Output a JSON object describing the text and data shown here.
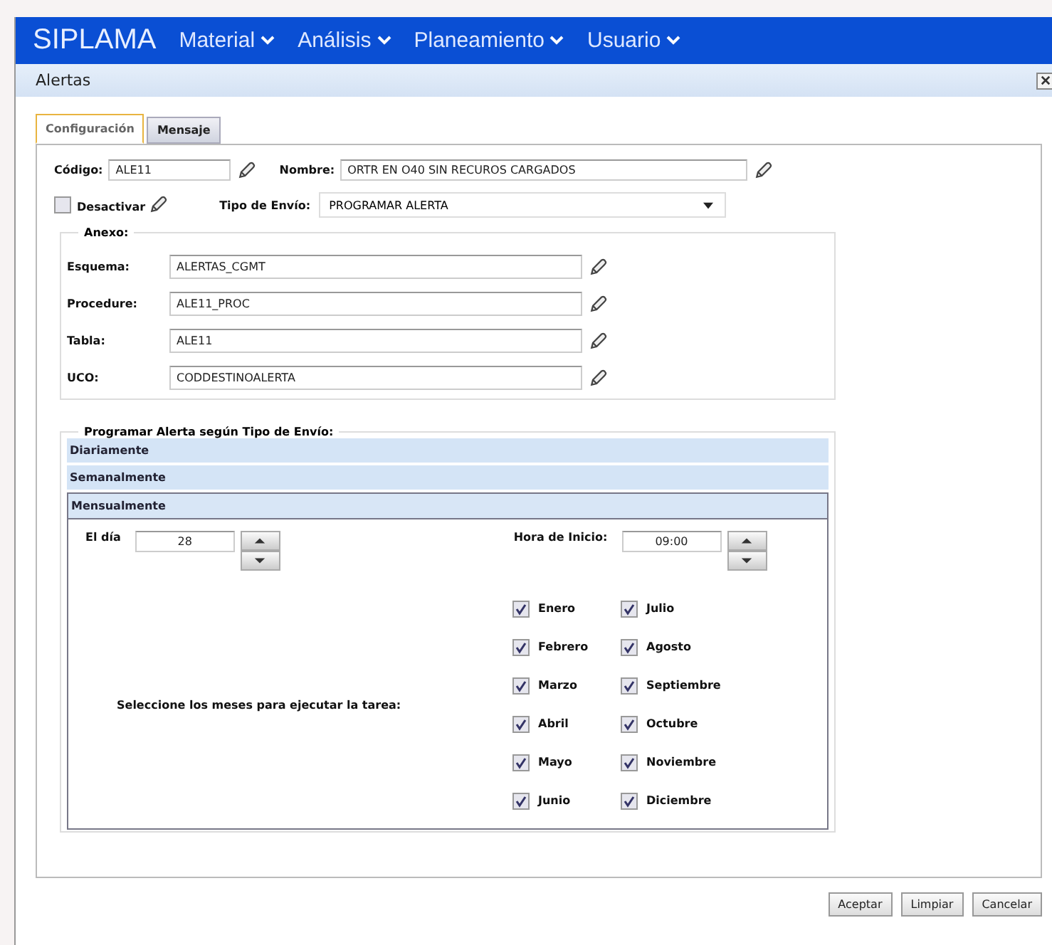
{
  "nav": {
    "brand": "SIPLAMA",
    "menus": [
      "Material",
      "Análisis",
      "Planeamiento",
      "Usuario"
    ]
  },
  "dialog": {
    "title": "Alertas"
  },
  "tabs": [
    {
      "label": "Configuración",
      "selected": true
    },
    {
      "label": "Mensaje",
      "selected": false
    }
  ],
  "codigo": {
    "label": "Código:",
    "value": "ALE11"
  },
  "nombre": {
    "label": "Nombre:",
    "value": "ORTR EN O40 SIN RECUROS CARGADOS"
  },
  "desactivar": {
    "label": "Desactivar",
    "checked": false
  },
  "tipo_envio": {
    "label": "Tipo de Envío:",
    "value": "PROGRAMAR ALERTA"
  },
  "anexo": {
    "legend": "Anexo:",
    "fields": [
      {
        "label": "Esquema:",
        "value": "ALERTAS_CGMT"
      },
      {
        "label": "Procedure:",
        "value": "ALE11_PROC"
      },
      {
        "label": "Tabla:",
        "value": "ALE11"
      },
      {
        "label": "UCO:",
        "value": "CODDESTINOALERTA"
      }
    ]
  },
  "programar": {
    "legend": "Programar Alerta según Tipo de Envío:",
    "sections": [
      {
        "label": "Diariamente",
        "selected": false
      },
      {
        "label": "Semanalmente",
        "selected": false
      },
      {
        "label": "Mensualmente",
        "selected": true
      }
    ],
    "dia": {
      "label": "El día",
      "value": "28"
    },
    "hora": {
      "label": "Hora de Inicio:",
      "value": "09:00"
    },
    "meses_label": "Seleccione los meses para ejecutar la tarea:",
    "meses": [
      {
        "label": "Enero",
        "checked": true
      },
      {
        "label": "Febrero",
        "checked": true
      },
      {
        "label": "Marzo",
        "checked": true
      },
      {
        "label": "Abril",
        "checked": true
      },
      {
        "label": "Mayo",
        "checked": true
      },
      {
        "label": "Junio",
        "checked": true
      },
      {
        "label": "Julio",
        "checked": true
      },
      {
        "label": "Agosto",
        "checked": true
      },
      {
        "label": "Septiembre",
        "checked": true
      },
      {
        "label": "Octubre",
        "checked": true
      },
      {
        "label": "Noviembre",
        "checked": true
      },
      {
        "label": "Diciembre",
        "checked": true
      }
    ]
  },
  "buttons": [
    "Aceptar",
    "Limpiar",
    "Cancelar"
  ]
}
